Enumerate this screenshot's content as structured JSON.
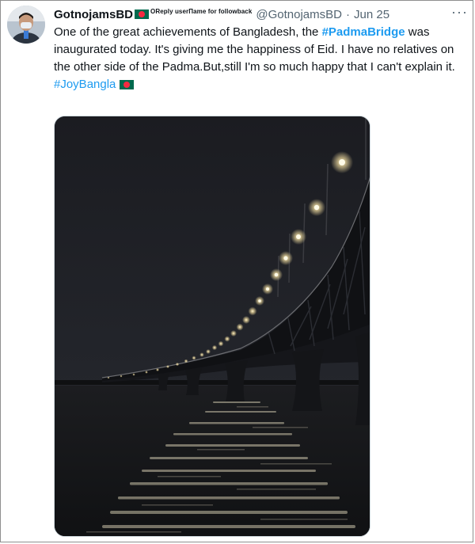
{
  "tweet": {
    "display_name": "GotnojamsBD",
    "tagline": "OReply userΠame for followback",
    "handle": "@GotnojamsBD",
    "separator": "·",
    "date": "Jun 25",
    "more_label": "···",
    "text_part1": "One of the great achievements of Bangladesh, the ",
    "hashtag1": "#PadmaBridge",
    "text_part2": " was inaugurated today. It's giving me the happiness of Eid. I have no relatives on the other side of the Padma.But,still I'm so much happy that I can't explain it.",
    "hashtag2": "#JoyBangla",
    "flag_icon": "bangladesh-flag-icon"
  },
  "colors": {
    "link": "#1d9bf0",
    "text": "#0f1419",
    "muted": "#536471",
    "flag_green": "#006a4e",
    "flag_red": "#f42a41"
  }
}
